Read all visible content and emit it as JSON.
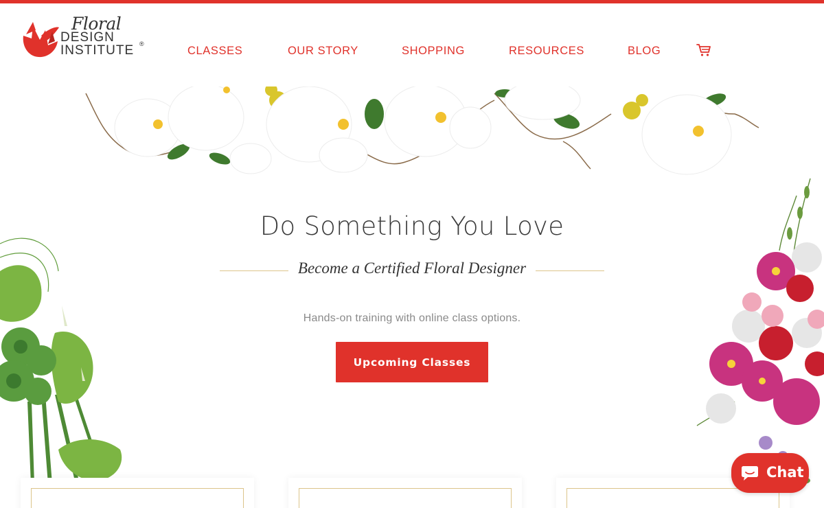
{
  "brand": {
    "logo_script": "Floral",
    "logo_line1": "DESIGN",
    "logo_line2": "INSTITUTE",
    "logo_mark": "®",
    "accent_color": "#e0322b",
    "gold_color": "#dcc48a"
  },
  "nav": {
    "items": [
      {
        "label": "CLASSES"
      },
      {
        "label": "OUR STORY"
      },
      {
        "label": "SHOPPING"
      },
      {
        "label": "RESOURCES"
      },
      {
        "label": "BLOG"
      }
    ],
    "cart_icon": "shopping-cart-icon"
  },
  "hero": {
    "headline": "Do Something You Love",
    "subline": "Become a Certified Floral Designer",
    "tagline": "Hands-on training with online class options.",
    "cta_label": "Upcoming Classes"
  },
  "chat": {
    "label": "Chat",
    "icon": "chat-bubble-icon"
  }
}
